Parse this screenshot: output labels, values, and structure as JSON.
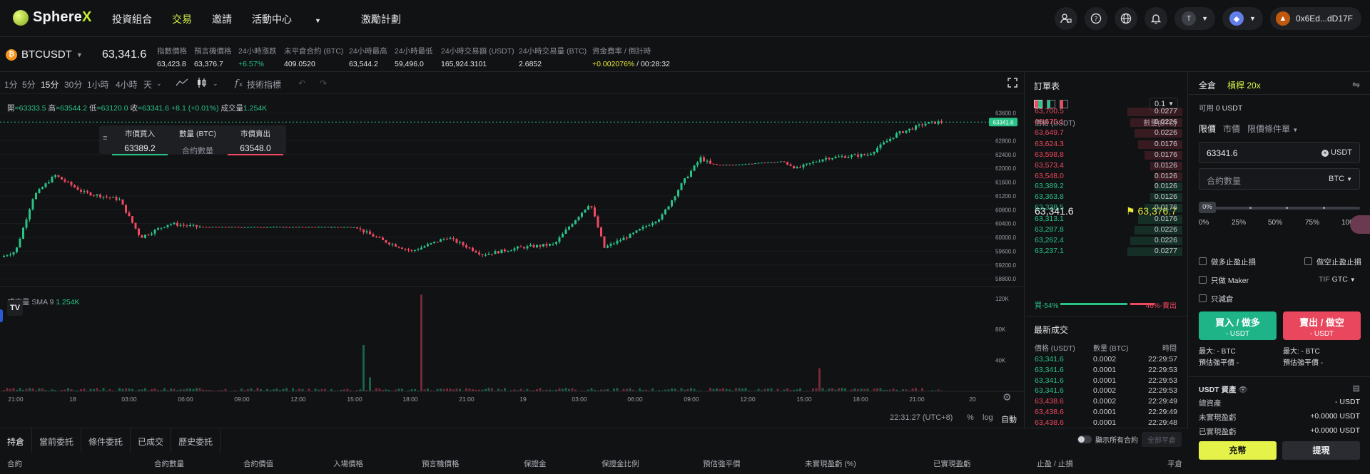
{
  "header": {
    "brand": "Sphere",
    "brand_x": "X",
    "nav": [
      {
        "label": "投資組合"
      },
      {
        "label": "交易"
      },
      {
        "label": "邀請"
      },
      {
        "label": "活動中心"
      },
      {
        "label": "激勵計劃"
      }
    ],
    "icons": [
      "user-wallet-icon",
      "help-icon",
      "globe-icon",
      "bell-icon"
    ],
    "account_initial": "T",
    "network_icon": "ethereum-icon",
    "wallet_address": "0x6Ed...dD17F"
  },
  "ticker": {
    "symbol": "BTCUSDT",
    "last_price": "63,341.6",
    "stats": [
      {
        "label": "指數價格",
        "value": "63,423.8"
      },
      {
        "label": "預言機價格",
        "value": "63,376.7"
      },
      {
        "label": "24小時漲跌",
        "value": "+6.57%"
      },
      {
        "label": "未平倉合約 (BTC)",
        "value": "409.0520"
      },
      {
        "label": "24小時最高",
        "value": "63,544.2"
      },
      {
        "label": "24小時最低",
        "value": "59,496.0"
      },
      {
        "label": "24小時交易額 (USDT)",
        "value": "165,924.3101"
      },
      {
        "label": "24小時交易量 (BTC)",
        "value": "2.6852"
      },
      {
        "label": "資金費率 / 倒計時",
        "value": "+0.002076%",
        "value2": " / 00:28:32"
      }
    ]
  },
  "chart_toolbar": {
    "timeframes": [
      "1分",
      "5分",
      "15分",
      "30分",
      "1小時",
      "4小時",
      "天"
    ],
    "selected_timeframe": "15分",
    "indicators_label": "技術指標"
  },
  "chart_overlay": {
    "ohlc_open_label": "開",
    "ohlc_open": "=63333.5",
    "ohlc_high_label": "高",
    "ohlc_high": "=63544.2",
    "ohlc_low_label": "低",
    "ohlc_low": "=63120.0",
    "ohlc_close_label": "收",
    "ohlc_close": "=63341.6 +8.1 (+0.01%)",
    "volume_label": "成交量",
    "volume_value": "1.254K",
    "market_buy_label": "市價買入",
    "market_buy_price": "63389.2",
    "qty_label": "數量 (BTC)",
    "qty_placeholder": "合約數量",
    "market_sell_label": "市價賣出",
    "market_sell_price": "63548.0",
    "vol_sma_label": "成交量 SMA 9",
    "vol_sma_value": "1.254K",
    "current_price_tag": "63341.6"
  },
  "chart_data": {
    "type": "candlestick",
    "interval": "15分",
    "y_axis_ticks": [
      "63600.0",
      "62800.0",
      "62400.0",
      "62000.0",
      "61600.0",
      "61200.0",
      "60800.0",
      "60400.0",
      "60000.0",
      "59600.0",
      "59200.0",
      "58800.0"
    ],
    "x_axis_ticks": [
      "21:00",
      "18",
      "03:00",
      "06:00",
      "09:00",
      "12:00",
      "15:00",
      "18:00",
      "21:00",
      "19",
      "03:00",
      "06:00",
      "09:00",
      "12:00",
      "15:00",
      "18:00",
      "21:00",
      "20"
    ],
    "volume_axis_ticks": [
      "120K",
      "80K",
      "40K"
    ],
    "last_close": 63341.6
  },
  "chart_footer": {
    "time": "22:31:27 (UTC+8)",
    "percent": "%",
    "log": "log",
    "auto": "自動"
  },
  "orderbook": {
    "title": "訂單表",
    "precision": "0.1",
    "col_price": "價格 (USDT)",
    "col_qty": "數量(BTC)",
    "asks": [
      {
        "price": "63,700.5",
        "qty": "0.0277",
        "depth": 0.55
      },
      {
        "price": "63,675.1",
        "qty": "0.0226",
        "depth": 0.52
      },
      {
        "price": "63,649.7",
        "qty": "0.0226",
        "depth": 0.48
      },
      {
        "price": "63,624.3",
        "qty": "0.0176",
        "depth": 0.44
      },
      {
        "price": "63,598.8",
        "qty": "0.0176",
        "depth": 0.38
      },
      {
        "price": "63,573.4",
        "qty": "0.0126",
        "depth": 0.32
      },
      {
        "price": "63,548.0",
        "qty": "0.0126",
        "depth": 0.28
      }
    ],
    "mid_price": "63,341.6",
    "mark_price": "63,376.7",
    "bids": [
      {
        "price": "63,389.2",
        "qty": "0.0126",
        "depth": 0.28
      },
      {
        "price": "63,363.8",
        "qty": "0.0126",
        "depth": 0.32
      },
      {
        "price": "63,338.5",
        "qty": "0.0176",
        "depth": 0.38
      },
      {
        "price": "63,313.1",
        "qty": "0.0176",
        "depth": 0.44
      },
      {
        "price": "63,287.8",
        "qty": "0.0226",
        "depth": 0.48
      },
      {
        "price": "63,262.4",
        "qty": "0.0226",
        "depth": 0.52
      },
      {
        "price": "63,237.1",
        "qty": "0.0277",
        "depth": 0.55
      }
    ],
    "buy_ratio_label": "買-54%",
    "sell_ratio_label": "46%-賣出",
    "buy_ratio": 0.54
  },
  "trades": {
    "title": "最新成交",
    "col_price": "價格 (USDT)",
    "col_qty": "數量 (BTC)",
    "col_time": "時間",
    "rows": [
      {
        "price": "63,341.6",
        "qty": "0.0002",
        "time": "22:29:57",
        "side": "buy"
      },
      {
        "price": "63,341.6",
        "qty": "0.0001",
        "time": "22:29:53",
        "side": "buy"
      },
      {
        "price": "63,341.6",
        "qty": "0.0001",
        "time": "22:29:53",
        "side": "buy"
      },
      {
        "price": "63,341.6",
        "qty": "0.0002",
        "time": "22:29:53",
        "side": "buy"
      },
      {
        "price": "63,438.6",
        "qty": "0.0002",
        "time": "22:29:49",
        "side": "sell"
      },
      {
        "price": "63,438.6",
        "qty": "0.0001",
        "time": "22:29:49",
        "side": "sell"
      },
      {
        "price": "63,438.6",
        "qty": "0.0001",
        "time": "22:29:48",
        "side": "sell"
      }
    ]
  },
  "trade_panel": {
    "margin_mode": "全倉",
    "leverage": "槓桿 20x",
    "available_label": "可用",
    "available_value": "0 USDT",
    "order_tabs": [
      "限價",
      "市價",
      "限價條件單"
    ],
    "price_value": "63341.6",
    "price_unit": "USDT",
    "qty_placeholder": "合約數量",
    "qty_unit": "BTC",
    "slider_value": "0%",
    "slider_level": 0,
    "slider_marks": [
      "0%",
      "25%",
      "50%",
      "75%",
      "100%"
    ],
    "tp_sl_long": "做多止盈止損",
    "tp_sl_short": "做空止盈止損",
    "maker_only": "只做 Maker",
    "tif_label": "TIF",
    "tif_value": "GTC",
    "reduce_only": "只減倉",
    "buy_label": "買入 / 做多",
    "buy_sub": "- USDT",
    "sell_label": "賣出 / 做空",
    "sell_sub": "- USDT",
    "max_label": "最大",
    "max_buy": ": - BTC",
    "max_sell": ": - BTC",
    "liq_label": "預估強平價",
    "liq_buy": "-",
    "liq_sell": "-",
    "assets_title": "USDT 資產",
    "assets": [
      {
        "label": "總資產",
        "value": "- USDT"
      },
      {
        "label": "未實現盈虧",
        "value": "+0.0000 USDT"
      },
      {
        "label": "已實現盈虧",
        "value": "+0.0000 USDT"
      }
    ],
    "deposit_label": "充幣",
    "withdraw_label": "提現"
  },
  "positions": {
    "tabs": [
      "持倉",
      "當前委託",
      "條件委託",
      "已成交",
      "歷史委託"
    ],
    "show_all": "顯示所有合約",
    "close_all": "全部平倉",
    "columns": [
      "合約",
      "合約數量",
      "合約價值",
      "入場價格",
      "預言機價格",
      "保證金",
      "保證金比例",
      "預估強平價",
      "未實現盈虧 (%)",
      "已實現盈虧",
      "止盈 / 止損",
      "平倉"
    ]
  },
  "colors": {
    "accent": "#d6f24a",
    "up": "#29c287",
    "down": "#f04860",
    "background": "#111214"
  }
}
